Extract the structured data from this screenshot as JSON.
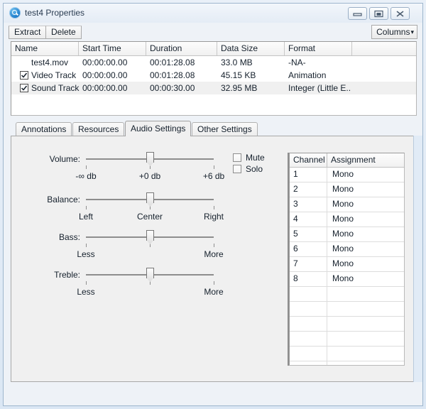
{
  "window": {
    "title": "test4 Properties",
    "icon": "quicktime-app-icon",
    "controls": {
      "minimize": "minimize-icon",
      "maximize": "maximize-icon",
      "close": "close-icon"
    }
  },
  "toolbar": {
    "extract_label": "Extract",
    "delete_label": "Delete",
    "columns_label": "Columns",
    "columns_caret": "▾"
  },
  "track_table": {
    "columns": [
      "Name",
      "Start Time",
      "Duration",
      "Data Size",
      "Format",
      ""
    ],
    "rows": [
      {
        "checkbox": null,
        "name": "test4.mov",
        "start_time": "00:00:00.00",
        "duration": "00:01:28.08",
        "data_size": "33.0 MB",
        "format": "-NA-",
        "selected": false
      },
      {
        "checkbox": "checked",
        "name": "Video Track",
        "start_time": "00:00:00.00",
        "duration": "00:01:28.08",
        "data_size": "45.15 KB",
        "format": "Animation",
        "selected": false
      },
      {
        "checkbox": "checked",
        "name": "Sound Track",
        "start_time": "00:00:00.00",
        "duration": "00:00:30.00",
        "data_size": "32.95 MB",
        "format": "Integer (Little E...",
        "selected": true
      }
    ]
  },
  "tabs": [
    {
      "label": "Annotations",
      "active": false
    },
    {
      "label": "Resources",
      "active": false
    },
    {
      "label": "Audio Settings",
      "active": true
    },
    {
      "label": "Other Settings",
      "active": false
    }
  ],
  "audio_settings": {
    "sliders": [
      {
        "label": "Volume:",
        "min_caption": "-∞ db",
        "mid_caption": "+0 db",
        "max_caption": "+6 db",
        "value_position_pct": 50
      },
      {
        "label": "Balance:",
        "min_caption": "Left",
        "mid_caption": "Center",
        "max_caption": "Right",
        "value_position_pct": 50
      },
      {
        "label": "Bass:",
        "min_caption": "Less",
        "mid_caption": "",
        "max_caption": "More",
        "value_position_pct": 50
      },
      {
        "label": "Treble:",
        "min_caption": "Less",
        "mid_caption": "",
        "max_caption": "More",
        "value_position_pct": 50
      }
    ],
    "checkboxes": [
      {
        "label": "Mute",
        "checked": false
      },
      {
        "label": "Solo",
        "checked": false
      }
    ],
    "channel_table": {
      "columns": [
        "Channel",
        "Assignment"
      ],
      "rows": [
        {
          "channel": "1",
          "assignment": "Mono"
        },
        {
          "channel": "2",
          "assignment": "Mono"
        },
        {
          "channel": "3",
          "assignment": "Mono"
        },
        {
          "channel": "4",
          "assignment": "Mono"
        },
        {
          "channel": "5",
          "assignment": "Mono"
        },
        {
          "channel": "6",
          "assignment": "Mono"
        },
        {
          "channel": "7",
          "assignment": "Mono"
        },
        {
          "channel": "8",
          "assignment": "Mono"
        },
        {
          "channel": "",
          "assignment": ""
        },
        {
          "channel": "",
          "assignment": ""
        },
        {
          "channel": "",
          "assignment": ""
        },
        {
          "channel": "",
          "assignment": ""
        },
        {
          "channel": "",
          "assignment": ""
        },
        {
          "channel": "",
          "assignment": ""
        },
        {
          "channel": "",
          "assignment": ""
        }
      ]
    }
  },
  "colors": {
    "window_chrome": "#e9f0f8",
    "pane_bg": "#f0f0f0",
    "selection": "#f0f0f0",
    "accent": "#1878c8",
    "scrollbar_track": "#e1ebf6"
  }
}
